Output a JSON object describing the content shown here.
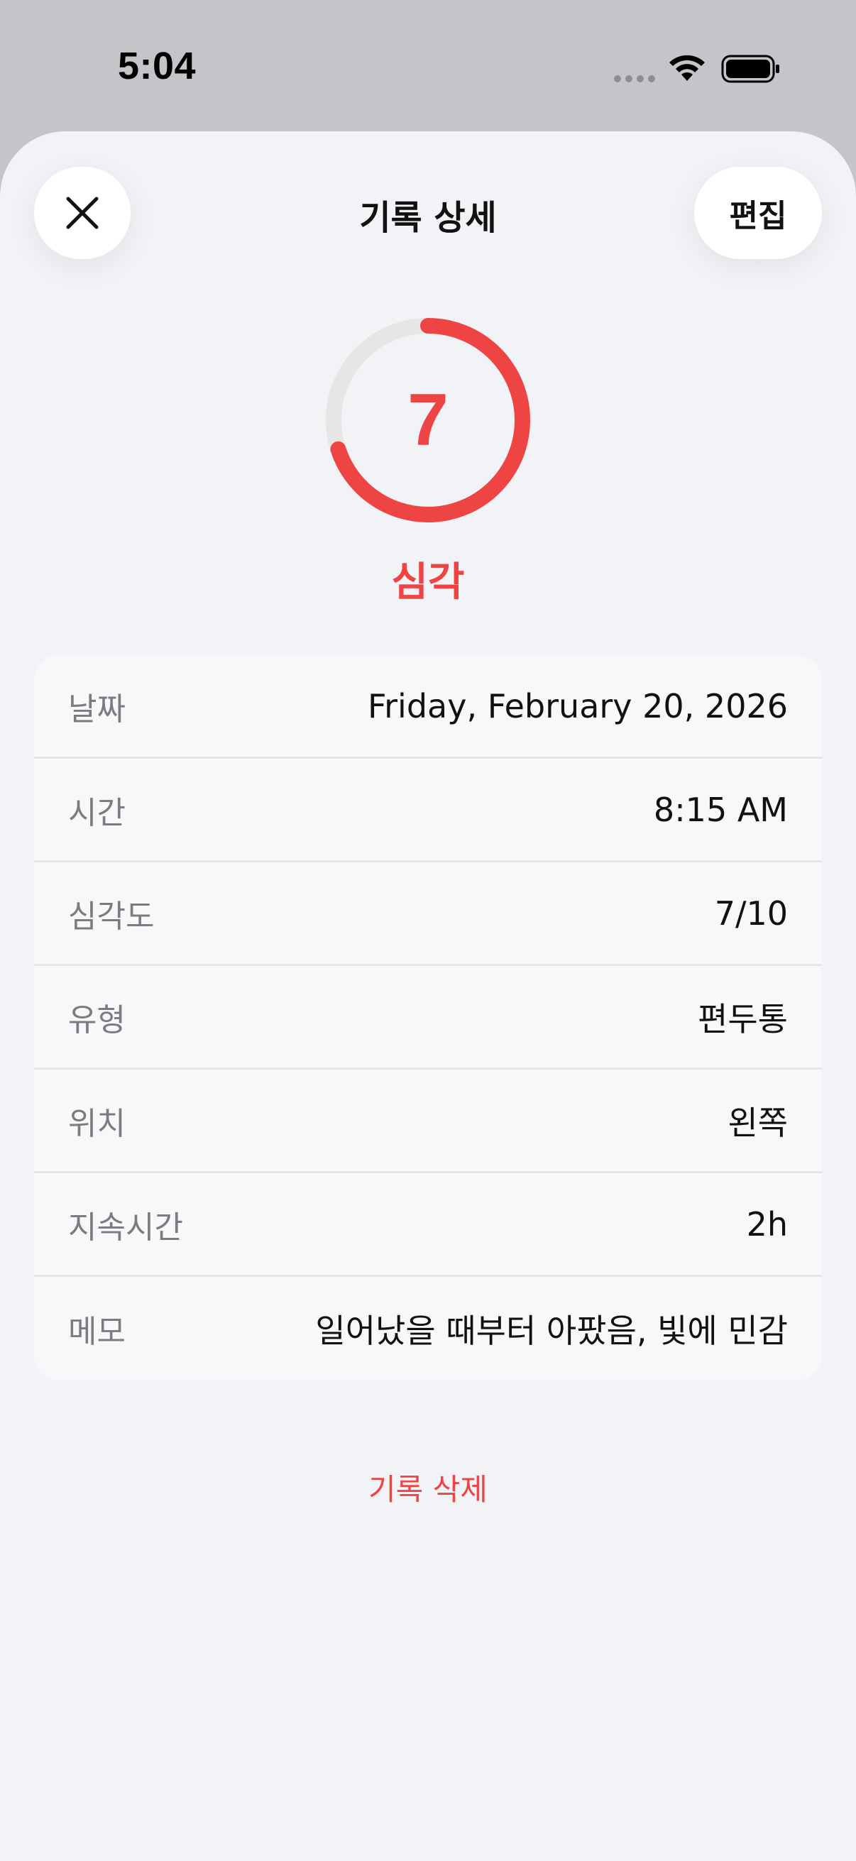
{
  "status_bar": {
    "time": "5:04"
  },
  "header": {
    "title": "기록 상세",
    "edit_label": "편집",
    "close_icon": "close-icon"
  },
  "severity": {
    "value": "7",
    "max": 10,
    "fraction": 0.7,
    "label": "심각",
    "color": "#ef4444",
    "track_color": "#e8e5e5"
  },
  "details": [
    {
      "label": "날짜",
      "value": "Friday, February 20, 2026"
    },
    {
      "label": "시간",
      "value": "8:15 AM"
    },
    {
      "label": "심각도",
      "value": "7/10"
    },
    {
      "label": "유형",
      "value": "편두통"
    },
    {
      "label": "위치",
      "value": "왼쪽"
    },
    {
      "label": "지속시간",
      "value": "2h"
    },
    {
      "label": "메모",
      "value": "일어났을 때부터 아팠음, 빛에 민감"
    }
  ],
  "actions": {
    "delete_label": "기록 삭제"
  }
}
